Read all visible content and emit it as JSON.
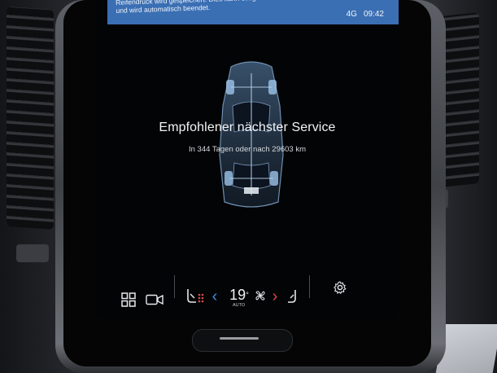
{
  "notice": {
    "text": "Reifendruck wird gespeichert. Dies kann einige Zeit dauern und wird automatisch beendet."
  },
  "status_bar": {
    "signal": "4G",
    "time": "09:42"
  },
  "service": {
    "title": "Empfohlener nächster Service",
    "subtitle": "In 344 Tagen oder nach 29603 km"
  },
  "climate_bar": {
    "temperature": "19",
    "unit": "°",
    "mode": "AUTO"
  },
  "colors": {
    "notice_bar": "#3b6fb4",
    "left_arrow": "#3a8ee6",
    "right_arrow": "#e0414b",
    "heat_dots": "#d94a4a"
  }
}
